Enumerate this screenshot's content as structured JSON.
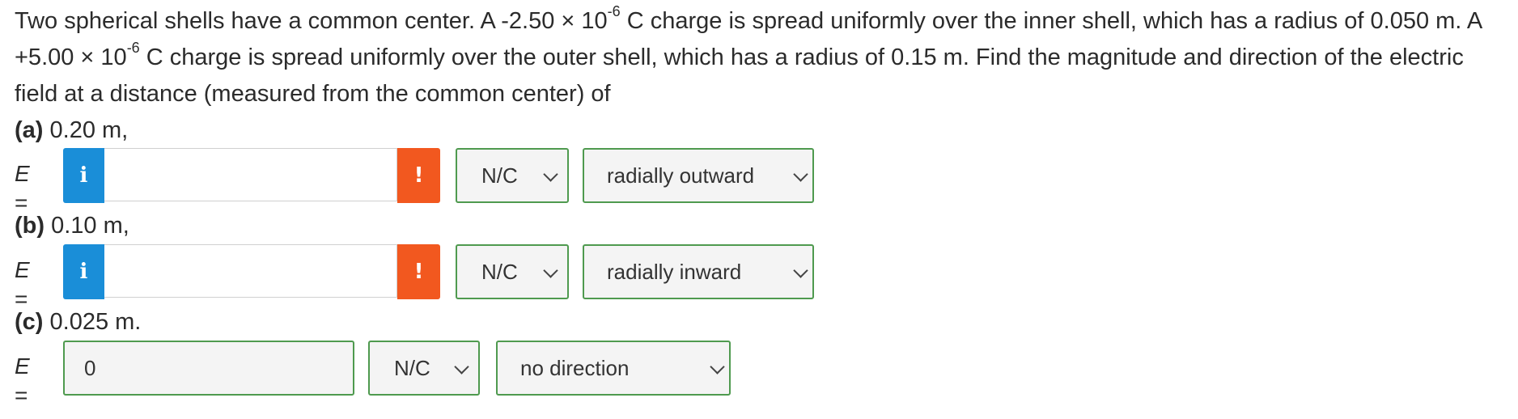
{
  "problem": {
    "part1": "Two spherical shells have a common center. A -2.50 × 10",
    "exp1": "-6",
    "part2": " C charge is spread uniformly over the inner shell, which has a radius of 0.050 m. A +5.00 × 10",
    "exp2": "-6",
    "part3": " C charge is spread uniformly over the outer shell, which has a radius of 0.15 m. Find the magnitude and direction of the electric field at a distance (measured from the common center) of"
  },
  "parts": [
    {
      "tag": "(a)",
      "text": " 0.20 m,",
      "e_label": "E",
      "eq": " =",
      "info_icon": "i",
      "warn_icon": "!",
      "value": "",
      "unit": "N/C",
      "direction": "radially outward"
    },
    {
      "tag": "(b)",
      "text": " 0.10 m,",
      "e_label": "E",
      "eq": " =",
      "info_icon": "i",
      "warn_icon": "!",
      "value": "",
      "unit": "N/C",
      "direction": "radially inward"
    },
    {
      "tag": "(c)",
      "text": " 0.025 m.",
      "e_label": "E",
      "eq": " =",
      "value": "0",
      "unit": "N/C",
      "direction": "no direction"
    }
  ],
  "icons": {
    "info": "info-icon",
    "warning": "warning-icon",
    "chevron": "chevron-down-icon"
  },
  "colors": {
    "info": "#1a8ed8",
    "warning": "#f2581f",
    "correct_border": "#4f9a4f"
  }
}
